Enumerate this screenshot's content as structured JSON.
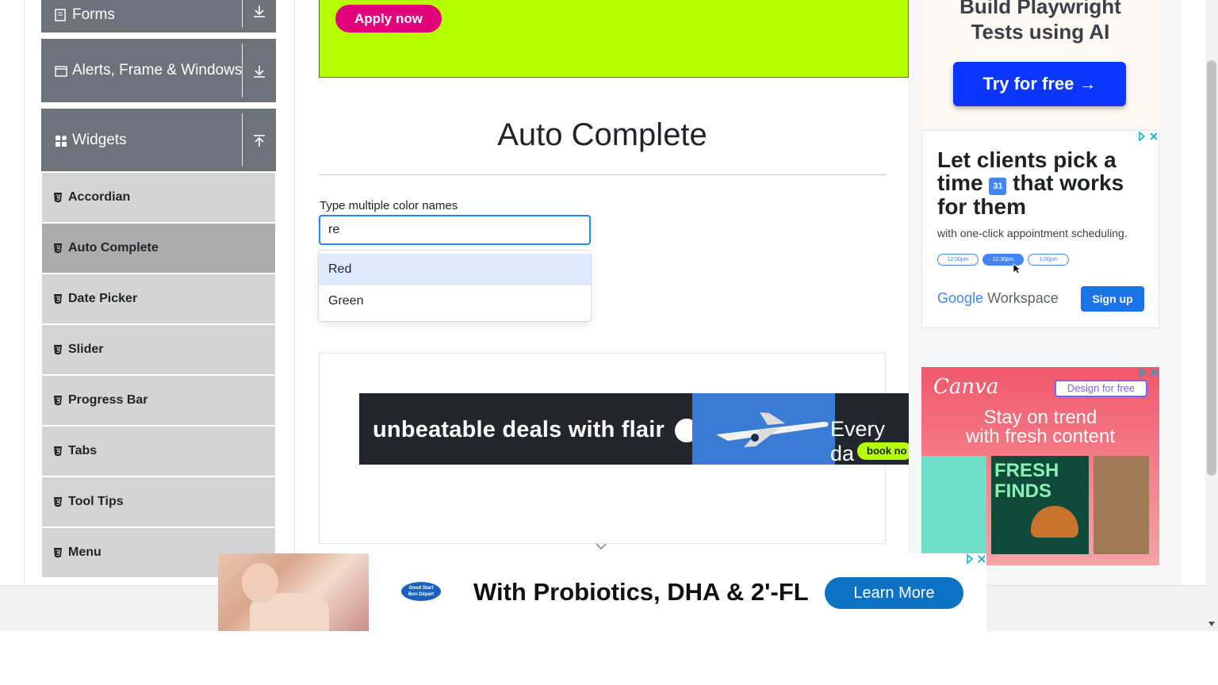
{
  "sidebar": {
    "groups": [
      {
        "label": "Forms",
        "icon": "document-icon",
        "toggle_icon": "download-arrow-icon"
      },
      {
        "label": "Alerts, Frame & Windows",
        "icon": "window-icon",
        "toggle_icon": "download-arrow-icon"
      },
      {
        "label": "Widgets",
        "icon": "grid-icon",
        "toggle_icon": "upload-arrow-icon"
      }
    ],
    "items": [
      {
        "label": "Accordian"
      },
      {
        "label": "Auto Complete",
        "active": true
      },
      {
        "label": "Date Picker"
      },
      {
        "label": "Slider"
      },
      {
        "label": "Progress Bar"
      },
      {
        "label": "Tabs"
      },
      {
        "label": "Tool Tips"
      },
      {
        "label": "Menu"
      }
    ]
  },
  "top_ad": {
    "button_label": "Apply now",
    "background": "#b5ff00",
    "button_color": "#e2007a"
  },
  "main": {
    "title": "Auto Complete",
    "multi_label": "Type multiple color names",
    "multi_input_value": "re",
    "suggestions": [
      "Red",
      "Green"
    ],
    "focused_suggestion": "Red"
  },
  "flair_ad": {
    "text": "unbeatable deals with flair",
    "text2": "Every da",
    "cta": "book no"
  },
  "right_ads": {
    "playwright": {
      "title_line1": "Build Playwright",
      "title_line2": "Tests using AI",
      "button": "Try for free →"
    },
    "google": {
      "head1": "Let clients pick a",
      "head2a": "time",
      "cal": "31",
      "head2b": "that works",
      "head3": "for them",
      "sub": "with one-click appointment scheduling.",
      "slots": [
        "12:00pm",
        "12:30pm",
        "1:00pm"
      ],
      "logo": "Google",
      "logo2": "Workspace",
      "signup": "Sign up"
    },
    "canva": {
      "logo": "Canva",
      "design_btn": "Design for free",
      "tag1": "Stay on trend",
      "tag2": "with fresh content",
      "fresh1": "FRESH",
      "fresh2": "FINDS"
    }
  },
  "bottom_ad": {
    "brand1": "Good Start",
    "brand2": "Bon Départ",
    "text": "With Probiotics, DHA & 2'-FL",
    "button": "Learn More"
  }
}
